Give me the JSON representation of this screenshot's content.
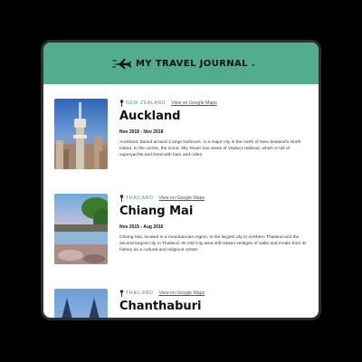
{
  "header": {
    "title": "MY TRAVEL JOURNAL .",
    "logo_icon": "airplane-icon",
    "background": "#52ad8e"
  },
  "entries": [
    {
      "country": "NEW ZEALAND",
      "map_link": "View on Google Maps",
      "city": "Auckland",
      "dates": "Nov 2018 - Nov 2018",
      "description": "Auckland, based around 2 large harbours, is a major city in the north of New Zealand's North Island. In the centre, the iconic Sky Tower has views of Viaduct Harbour, which is full of superyachts and lined with bars and cafes."
    },
    {
      "country": "THAILAND",
      "map_link": "View on Google Maps",
      "city": "Chiang Mai",
      "dates": "Nov 2015 - Aug 2016",
      "description": "Chiang Mai, located in a mountainous region, is the largest city in northern Thailand and the second largest city in Thailand. Its Old City area still retains vestiges of walls and moats from its history as a cultural and religious center."
    },
    {
      "country": "THAILAND",
      "map_link": "View on Google Maps",
      "city": "Chanthaburi",
      "dates": "",
      "description": ""
    }
  ],
  "colors": {
    "accent": "#52ad8e",
    "country_text": "#3b9a78",
    "frame": "#2d2f33"
  }
}
